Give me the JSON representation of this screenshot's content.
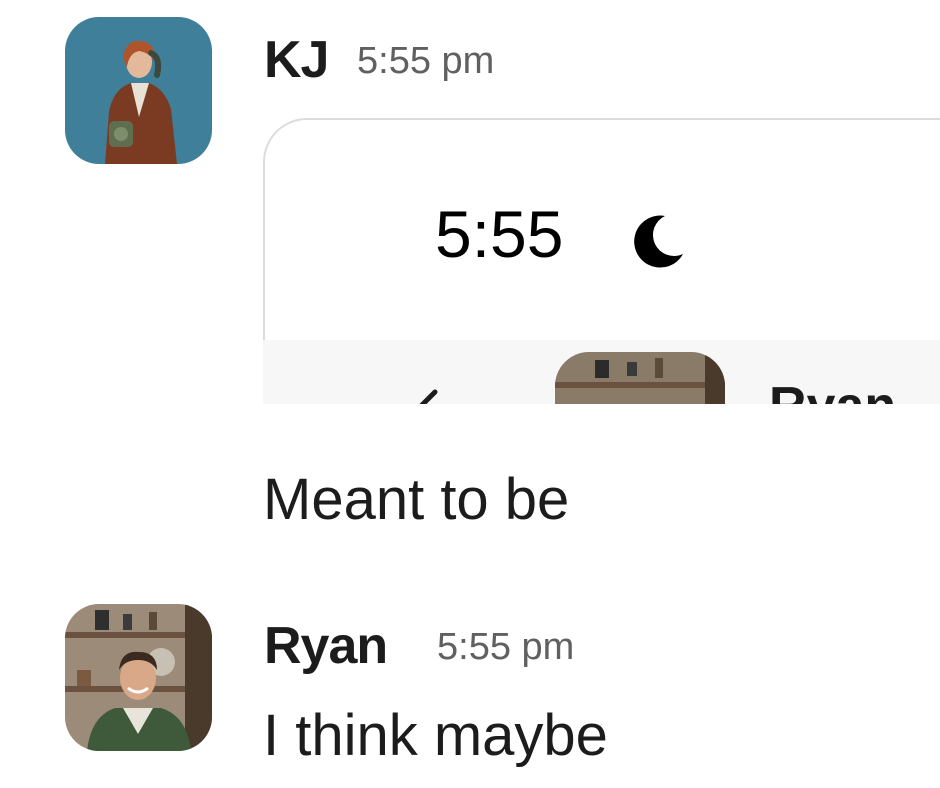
{
  "messages": [
    {
      "author": "KJ",
      "time": "5:55 pm",
      "attachment": {
        "clock": "5:55",
        "moon_icon": "moon-icon",
        "inner_name": "Ryan",
        "back_icon": "chevron-left-icon"
      },
      "text": "Meant to be"
    },
    {
      "author": "Ryan",
      "time": "5:55 pm",
      "text": "I think maybe"
    }
  ]
}
